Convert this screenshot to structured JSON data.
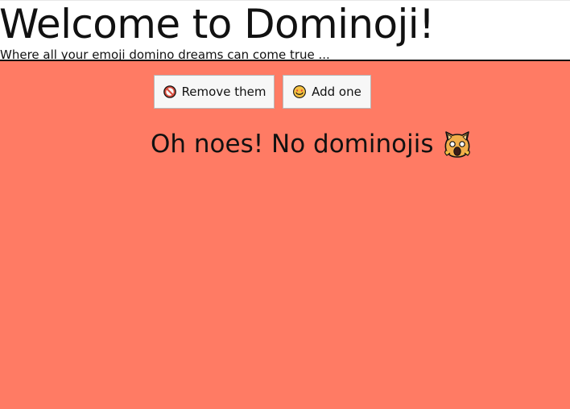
{
  "header": {
    "title": "Welcome to Dominoji!",
    "tagline": "Where all your emoji domino dreams can come true ..."
  },
  "actions": {
    "remove": {
      "label": "Remove them",
      "icon": "prohibited-icon"
    },
    "add": {
      "label": "Add one",
      "icon": "heart-eyes-icon"
    }
  },
  "empty_state": {
    "message": "Oh noes! No dominojis",
    "icon": "weary-cat-icon"
  },
  "colors": {
    "background": "#ff7b64",
    "header_background": "#ffffff",
    "text": "#111111",
    "button_background": "#f7f7f7"
  }
}
